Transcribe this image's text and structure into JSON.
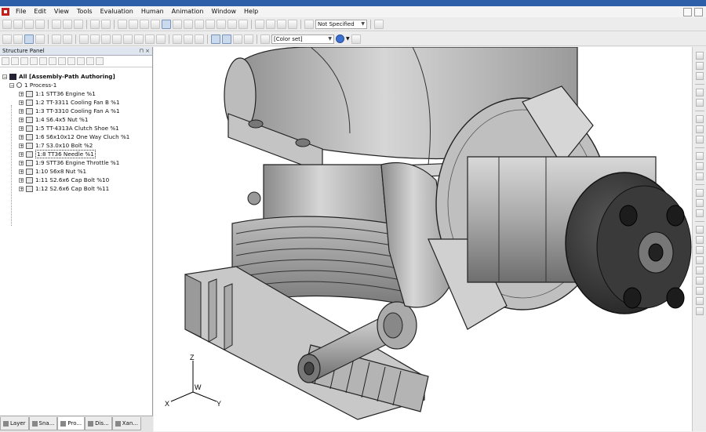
{
  "menu": [
    "File",
    "Edit",
    "View",
    "Tools",
    "Evaluation",
    "Human",
    "Animation",
    "Window",
    "Help"
  ],
  "toolbar": {
    "specification_value": "Not Specified",
    "color_set_value": "[Color set]"
  },
  "structure_panel": {
    "title": "Structure Panel",
    "pin": "⊓ ×",
    "root": "All [Assembly-Path Authoring]",
    "process": "1 Process-1",
    "items": [
      "1:1 STT36 Engine %1",
      "1:2 TT-3311 Cooling Fan B %1",
      "1:3 TT-3310 Cooling Fan A %1",
      "1:4 S6.4x5 Nut %1",
      "1:5 TT-4313A Clutch Shoe %1",
      "1:6 S6x10x12 One Way Cluch %1",
      "1:7 S3.0x10 Bolt %2",
      "1:8 TT36 Needle %1",
      "1:9 STT36 Engine Throttle %1",
      "1:10 S6x8 Nut %1",
      "1:11 S2.6x6 Cap Bolt %10",
      "1:12 S2.6x6 Cap Bolt %11"
    ],
    "selected_index": 7
  },
  "bottom_tabs": [
    "Layer",
    "Sna...",
    "Pro...",
    "Dis...",
    "Xan..."
  ],
  "axes": {
    "z": "Z",
    "w": "W",
    "x": "X",
    "y": "Y"
  },
  "colors": {
    "accent": "#2c5fa8",
    "selection": "#c9d9ee"
  }
}
